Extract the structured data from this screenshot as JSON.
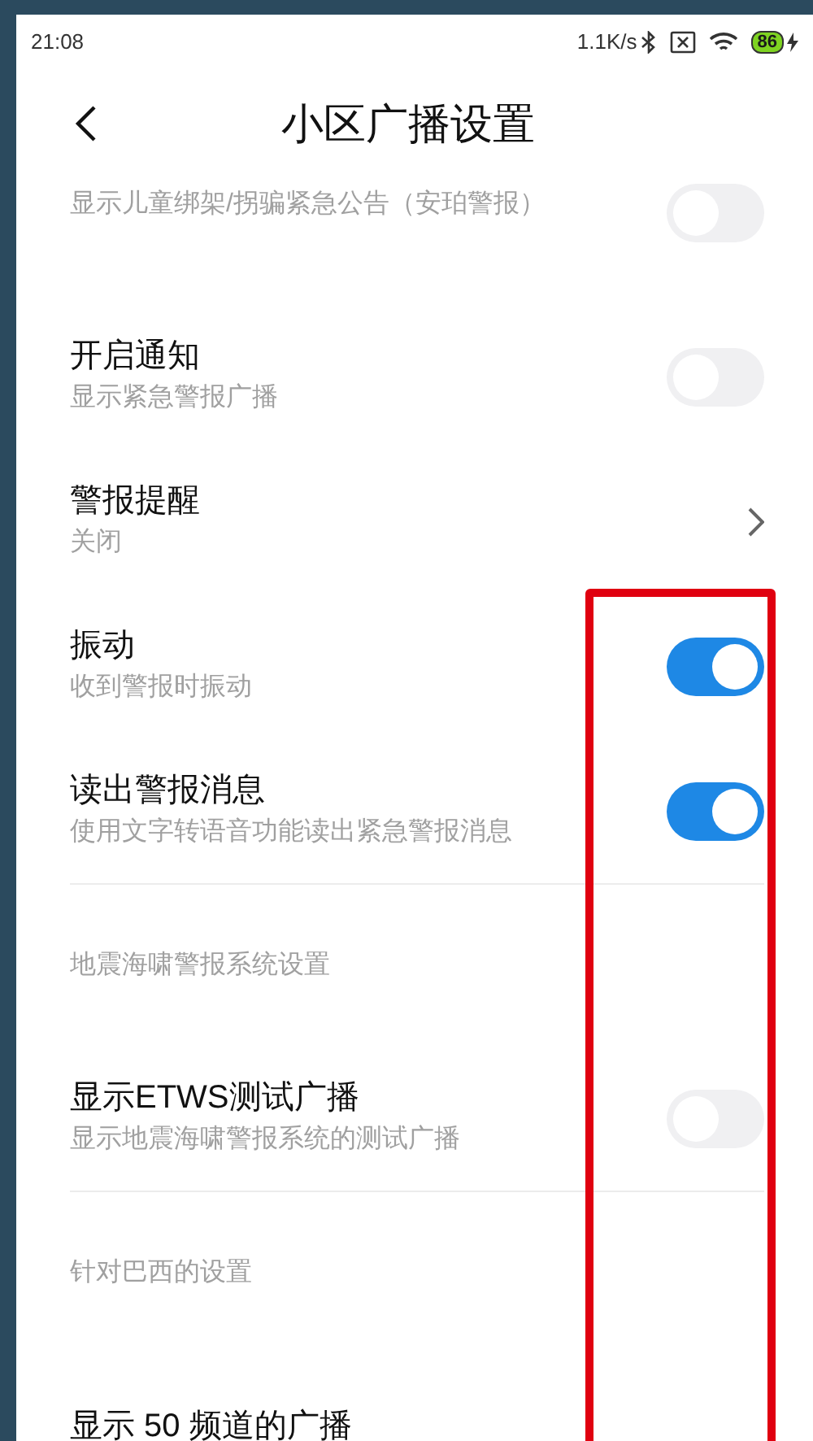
{
  "status_bar": {
    "time": "21:08",
    "speed": "1.1K/s",
    "battery": "86"
  },
  "header": {
    "title": "小区广播设置"
  },
  "items": [
    {
      "kind": "toggle",
      "subtitle": "显示儿童绑架/拐骗紧急公告（安珀警报）",
      "on": false
    },
    {
      "kind": "toggle",
      "title": "开启通知",
      "subtitle": "显示紧急警报广播",
      "on": false
    },
    {
      "kind": "link",
      "title": "警报提醒",
      "subtitle": "关闭"
    },
    {
      "kind": "toggle",
      "title": "振动",
      "subtitle": "收到警报时振动",
      "on": true
    },
    {
      "kind": "toggle",
      "title": "读出警报消息",
      "subtitle": "使用文字转语音功能读出紧急警报消息",
      "on": true
    },
    {
      "kind": "section",
      "title": "地震海啸警报系统设置"
    },
    {
      "kind": "toggle",
      "title": "显示ETWS测试广播",
      "subtitle": "显示地震海啸警报系统的测试广播",
      "on": false
    },
    {
      "kind": "section",
      "title": "针对巴西的设置"
    },
    {
      "kind": "plain",
      "title": "显示 50 频道的广播"
    }
  ]
}
